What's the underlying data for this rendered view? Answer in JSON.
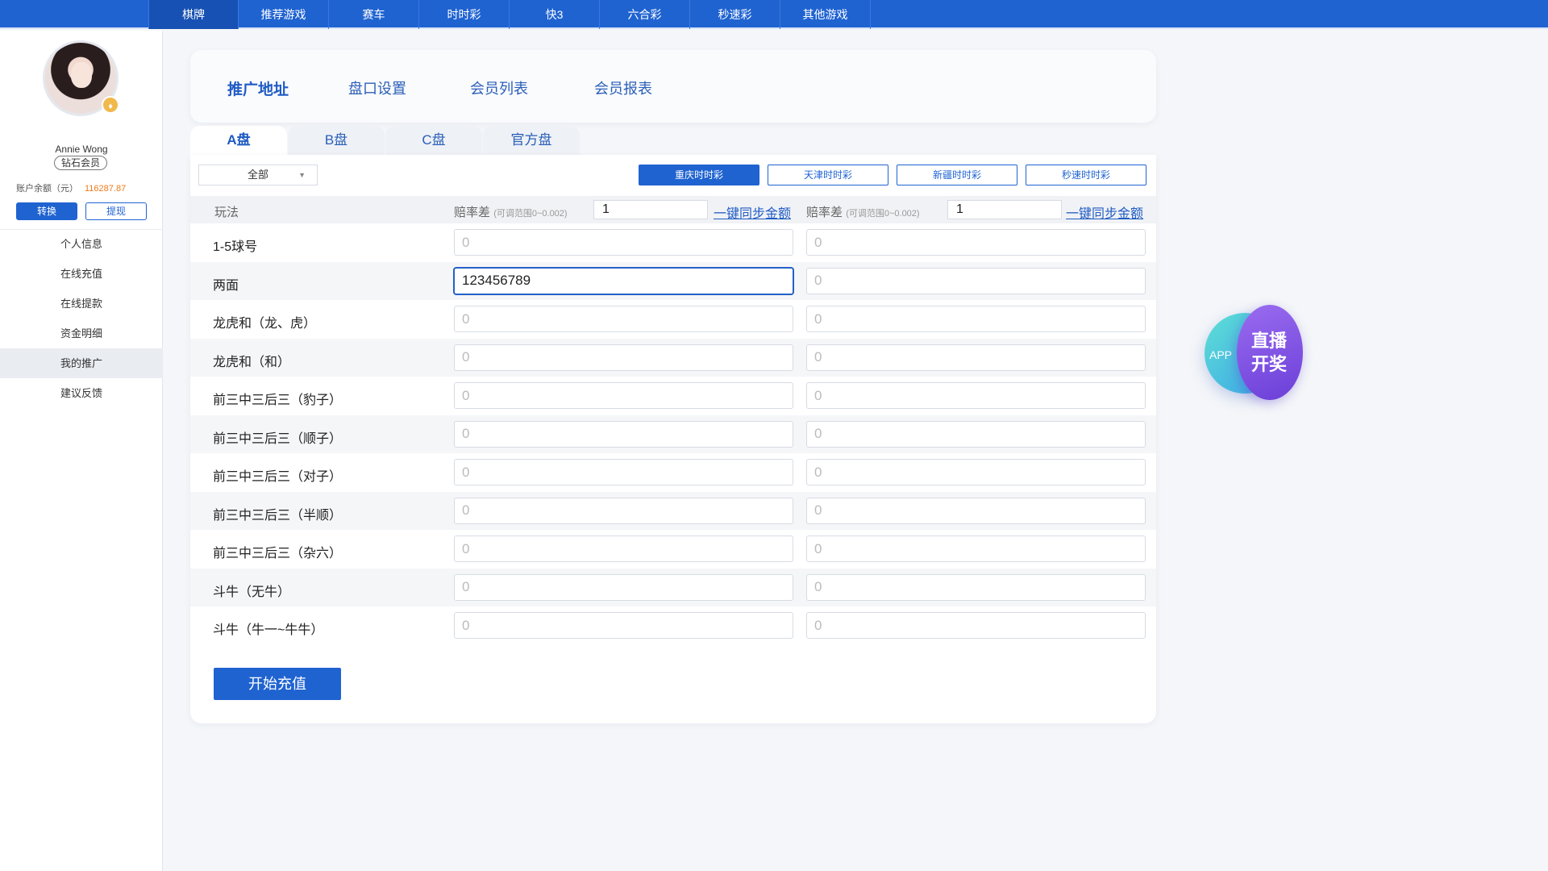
{
  "topnav": {
    "items": [
      "棋牌",
      "推荐游戏",
      "赛车",
      "时时彩",
      "快3",
      "六合彩",
      "秒速彩",
      "其他游戏"
    ]
  },
  "sidebar": {
    "username": "Annie Wong",
    "member_level": "钻石会员",
    "balance_label": "账户余额（元）",
    "balance_value": "116287.87",
    "transfer_label": "转换",
    "withdraw_label": "提现",
    "menu": [
      "个人信息",
      "在线充值",
      "在线提款",
      "资金明细",
      "我的推广",
      "建议反馈"
    ],
    "active_menu": "我的推广"
  },
  "header_tabs": [
    "推广地址",
    "盘口设置",
    "会员列表",
    "会员报表"
  ],
  "sub_tabs": [
    "A盘",
    "B盘",
    "C盘",
    "官方盘"
  ],
  "filter": {
    "selected": "全部"
  },
  "lottery_buttons": [
    "重庆时时彩",
    "天津时时彩",
    "新疆时时彩",
    "秒速时时彩"
  ],
  "table": {
    "col_play": "玩法",
    "col_odds_label": "赔率差",
    "col_odds_range": "(可调范围0~0.002)",
    "col_odds_value_1": "1",
    "col_odds_value_2": "1",
    "sync_label": "一键同步金额",
    "placeholder": "0",
    "rows": [
      {
        "name": "1-5球号",
        "v1": "",
        "v2": ""
      },
      {
        "name": "两面",
        "v1": "123456789",
        "v2": ""
      },
      {
        "name": "龙虎和（龙、虎）",
        "v1": "",
        "v2": ""
      },
      {
        "name": "龙虎和（和）",
        "v1": "",
        "v2": ""
      },
      {
        "name": "前三中三后三（豹子）",
        "v1": "",
        "v2": ""
      },
      {
        "name": "前三中三后三（顺子）",
        "v1": "",
        "v2": ""
      },
      {
        "name": "前三中三后三（对子）",
        "v1": "",
        "v2": ""
      },
      {
        "name": "前三中三后三（半顺）",
        "v1": "",
        "v2": ""
      },
      {
        "name": "前三中三后三（杂六）",
        "v1": "",
        "v2": ""
      },
      {
        "name": "斗牛（无牛）",
        "v1": "",
        "v2": ""
      },
      {
        "name": "斗牛（牛一~牛牛）",
        "v1": "",
        "v2": ""
      }
    ]
  },
  "submit_label": "开始充值",
  "live_badge": {
    "app": "APP",
    "line1": "直播",
    "line2": "开奖"
  },
  "colors": {
    "primary": "#1f63d1",
    "accent_orange": "#ef7a1a",
    "live_purple": "#7b4fe0",
    "live_teal": "#4cc8e0"
  }
}
